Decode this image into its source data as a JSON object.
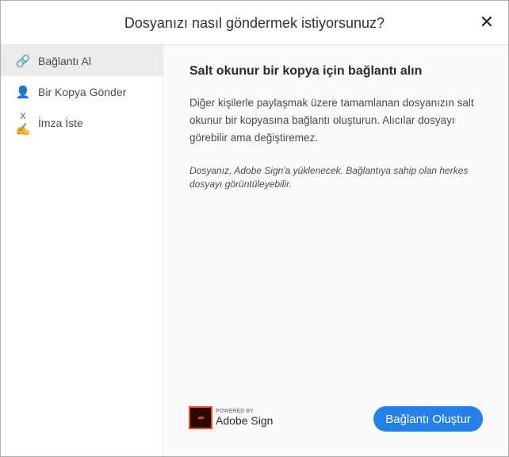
{
  "dialog": {
    "title": "Dosyanızı nasıl göndermek istiyorsunuz?",
    "close": "✕"
  },
  "sidebar": {
    "items": [
      {
        "label": "Bağlantı Al",
        "icon": "🔗"
      },
      {
        "label": "Bir Kopya Gönder",
        "icon": "👤"
      },
      {
        "label": "İmza İste",
        "icon": "x✍"
      }
    ]
  },
  "main": {
    "heading": "Salt okunur bir kopya için bağlantı alın",
    "description": "Diğer kişilerle paylaşmak üzere tamamlanan dosyanızın salt okunur bir kopyasına bağlantı oluşturun. Alıcılar dosyayı görebilir ama değiştiremez.",
    "note": "Dosyanız, Adobe Sign'a yüklenecek. Bağlantıya sahip olan herkes dosyayı görüntüleyebilir.",
    "powered_by": "POWERED BY",
    "brand": "Adobe Sign",
    "button": "Bağlantı Oluştur"
  }
}
